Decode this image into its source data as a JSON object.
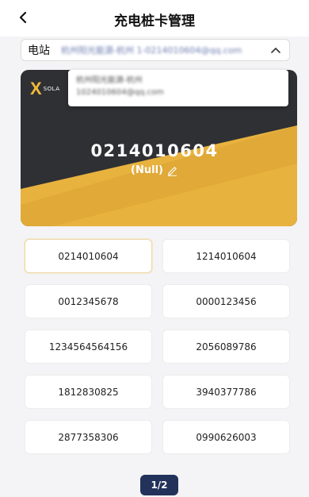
{
  "header": {
    "title": "充电桩卡管理",
    "back_icon": "chevron-left-icon"
  },
  "station": {
    "label": "电站",
    "value": "杭州阳光能源-杭州 1-0214010604@qq.com",
    "dropdown_icon": "chevron-up-icon"
  },
  "dropdown": {
    "lines": [
      "杭州阳光能源-杭州",
      "1024010604@qq.com"
    ]
  },
  "card": {
    "logo_text": "SOLA",
    "number": "0214010604",
    "name": "(Null)",
    "edit_icon": "pencil-icon",
    "colors": {
      "dark": "#2f3034",
      "gold": "#e8b23e"
    }
  },
  "cards": [
    {
      "number": "0214010604",
      "selected": true
    },
    {
      "number": "1214010604",
      "selected": false
    },
    {
      "number": "0012345678",
      "selected": false
    },
    {
      "number": "0000123456",
      "selected": false
    },
    {
      "number": "1234564564156",
      "selected": false
    },
    {
      "number": "2056089786",
      "selected": false
    },
    {
      "number": "1812830825",
      "selected": false
    },
    {
      "number": "3940377786",
      "selected": false
    },
    {
      "number": "2877358306",
      "selected": false
    },
    {
      "number": "0990626003",
      "selected": false
    }
  ],
  "pagination": {
    "label": "1/2"
  }
}
